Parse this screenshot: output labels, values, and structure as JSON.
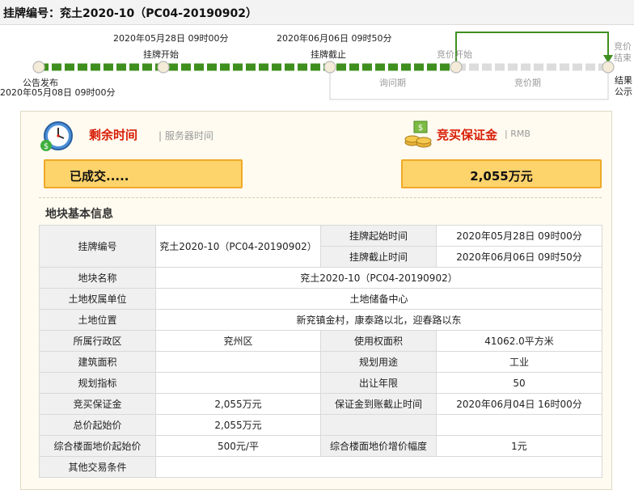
{
  "header": {
    "title": "挂牌编号：兖土2020-10（PC04-20190902）"
  },
  "timeline": {
    "announce_label": "公告发布",
    "announce_date": "2020年05月08日 09时00分",
    "listing_start_label": "挂牌开始",
    "listing_start_date": "2020年05月28日 09时00分",
    "listing_end_label": "挂牌截止",
    "listing_end_date": "2020年06月06日 09时50分",
    "bidding_start_label": "竞价开始",
    "bidding_end_label_1": "竞价",
    "bidding_end_label_2": "结束",
    "inquiry_period_label": "询问期",
    "bidding_period_label": "竞价期",
    "result_label_1": "结果",
    "result_label_2": "公示"
  },
  "panel": {
    "remaining_time_label": "剩余时间",
    "server_time_label": "| 服务器时间",
    "status_text": "已成交.....",
    "deposit_label": "竞买保证金",
    "deposit_unit_label": "| RMB",
    "deposit_amount": "2,055万元"
  },
  "info": {
    "section_title": "地块基本信息",
    "listing_no_label": "挂牌编号",
    "listing_no_value": "兖土2020-10（PC04-20190902）",
    "start_time_label": "挂牌起始时间",
    "start_time_value": "2020年05月28日 09时00分",
    "end_time_label": "挂牌截止时间",
    "end_time_value": "2020年06月06日 09时50分",
    "parcel_name_label": "地块名称",
    "parcel_name_value": "兖土2020-10（PC04-20190902）",
    "owner_label": "土地权属单位",
    "owner_value": "土地储备中心",
    "location_label": "土地位置",
    "location_value": "新兖镇金村，康泰路以北，迎春路以东",
    "district_label": "所属行政区",
    "district_value": "兖州区",
    "use_area_label": "使用权面积",
    "use_area_value": "41062.0平方米",
    "building_area_label": "建筑面积",
    "building_area_value": "",
    "planned_use_label": "规划用途",
    "planned_use_value": "工业",
    "planning_index_label": "规划指标",
    "planning_index_value": "",
    "term_label": "出让年限",
    "term_value": "50",
    "deposit_label": "竞买保证金",
    "deposit_value": "2,055万元",
    "deposit_deadline_label": "保证金到账截止时间",
    "deposit_deadline_value": "2020年06月04日 16时00分",
    "start_price_label": "总价起始价",
    "start_price_value": "2,055万元",
    "floor_price_label": "综合楼面地价起始价",
    "floor_price_value": "500元/平",
    "increment_label": "综合楼面地价增价幅度",
    "increment_value": "1元",
    "other_label": "其他交易条件",
    "other_value": ""
  },
  "colors": {
    "progress_done": "#3f8f1e",
    "progress_pending": "#dcdcdc",
    "accent_red": "#d81e06",
    "box_fill": "#fdd36b",
    "box_border": "#f0a928"
  }
}
